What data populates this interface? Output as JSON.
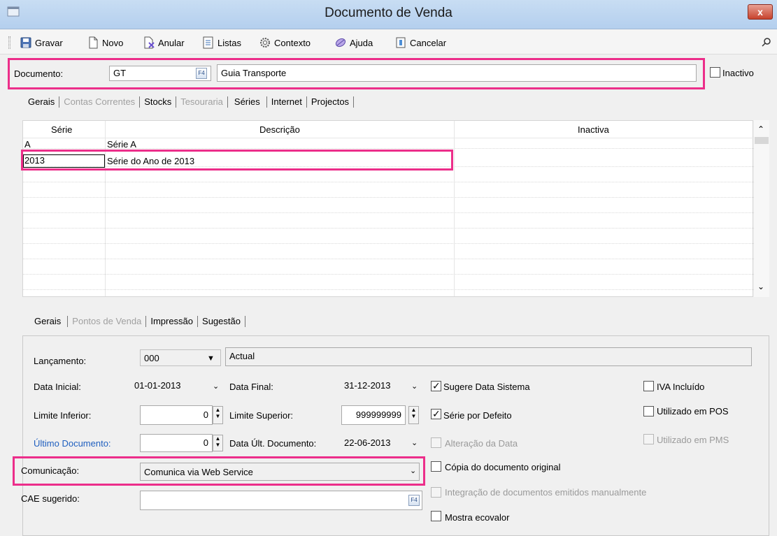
{
  "window": {
    "title": "Documento de Venda",
    "close": "x"
  },
  "toolbar": {
    "gravar": "Gravar",
    "novo": "Novo",
    "anular": "Anular",
    "listas": "Listas",
    "contexto": "Contexto",
    "ajuda": "Ajuda",
    "cancelar": "Cancelar"
  },
  "documento": {
    "label": "Documento:",
    "code": "GT",
    "description": "Guia Transporte",
    "inactivo": "Inactivo"
  },
  "main_tabs": [
    "Gerais",
    "Contas Correntes",
    "Stocks",
    "Tesouraria",
    "Séries",
    "Internet",
    "Projectos"
  ],
  "grid": {
    "headers": {
      "serie": "Série",
      "descricao": "Descrição",
      "inactiva": "Inactiva"
    },
    "rows": [
      {
        "serie": "A",
        "descricao": "Série A"
      },
      {
        "serie": "2013",
        "descricao": "Série do Ano de 2013"
      }
    ]
  },
  "sub_tabs": [
    "Gerais",
    "Pontos de Venda",
    "Impressão",
    "Sugestão"
  ],
  "form": {
    "lancamento_label": "Lançamento:",
    "lancamento_code": "000",
    "lancamento_desc": "Actual",
    "data_inicial_label": "Data Inicial:",
    "data_inicial": "01-01-2013",
    "data_final_label": "Data Final:",
    "data_final": "31-12-2013",
    "limite_inferior_label": "Limite Inferior:",
    "limite_inferior": "0",
    "limite_superior_label": "Limite Superior:",
    "limite_superior": "999999999",
    "ultimo_doc_label": "Último Documento:",
    "ultimo_doc": "0",
    "data_ult_label": "Data Últ. Documento:",
    "data_ult": "22-06-2013",
    "comunicacao_label": "Comunicação:",
    "comunicacao": "Comunica via Web Service",
    "cae_label": "CAE sugerido:",
    "cae": ""
  },
  "checks": {
    "sugere_data": "Sugere Data Sistema",
    "serie_defeito": "Série por Defeito",
    "alteracao_data": "Alteração da Data",
    "copia_original": "Cópia do documento original",
    "integracao": "Integração de documentos emitidos manualmente",
    "mostra_ecovalor": "Mostra ecovalor",
    "iva_incluido": "IVA Incluído",
    "utilizado_pos": "Utilizado em POS",
    "utilizado_pms": "Utilizado em PMS"
  },
  "colors": {
    "highlight": "#ec2e8a",
    "link_blue": "#1f5fbf"
  }
}
